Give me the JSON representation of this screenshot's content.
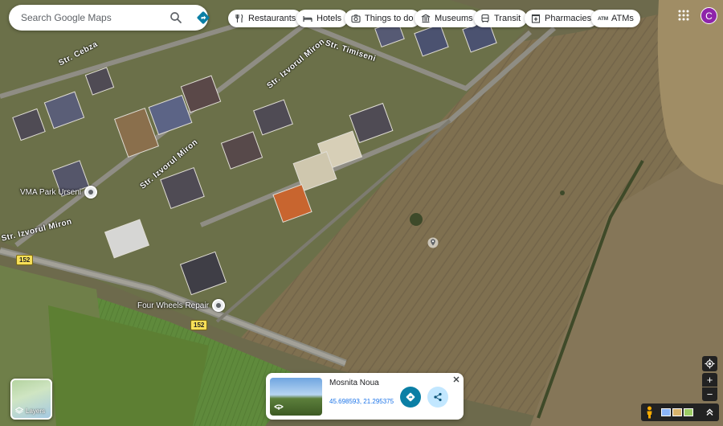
{
  "search": {
    "placeholder": "Search Google Maps",
    "value": ""
  },
  "chips": [
    {
      "label": "Restaurants",
      "icon": "restaurant-icon"
    },
    {
      "label": "Hotels",
      "icon": "hotel-icon"
    },
    {
      "label": "Things to do",
      "icon": "camera-icon"
    },
    {
      "label": "Museums",
      "icon": "museum-icon"
    },
    {
      "label": "Transit",
      "icon": "transit-icon"
    },
    {
      "label": "Pharmacies",
      "icon": "pharmacy-icon"
    },
    {
      "label": "ATMs",
      "icon": "atm-icon",
      "glyph": "ATM"
    }
  ],
  "account": {
    "initial": "C",
    "color": "#8e24aa"
  },
  "map": {
    "streets": [
      "Str. Cebza",
      "Str. Timiseni",
      "Str. Izvorul Miron",
      "Str. Izvorul Miron",
      "Str. Izvorul Miron"
    ],
    "route_shields": [
      "152",
      "152"
    ],
    "pois": [
      "VMA Park Urseni",
      "Four Wheels Repair"
    ]
  },
  "layers": {
    "label": "Layers"
  },
  "place_card": {
    "name": "Mosnita Noua",
    "coordinates": "45.698593, 21.295375"
  },
  "controls": {
    "zoom_in": "+",
    "zoom_out": "−"
  },
  "colors": {
    "accent": "#1a73e8",
    "directions": "#0b7fa5",
    "share": "#c2e7ff"
  }
}
